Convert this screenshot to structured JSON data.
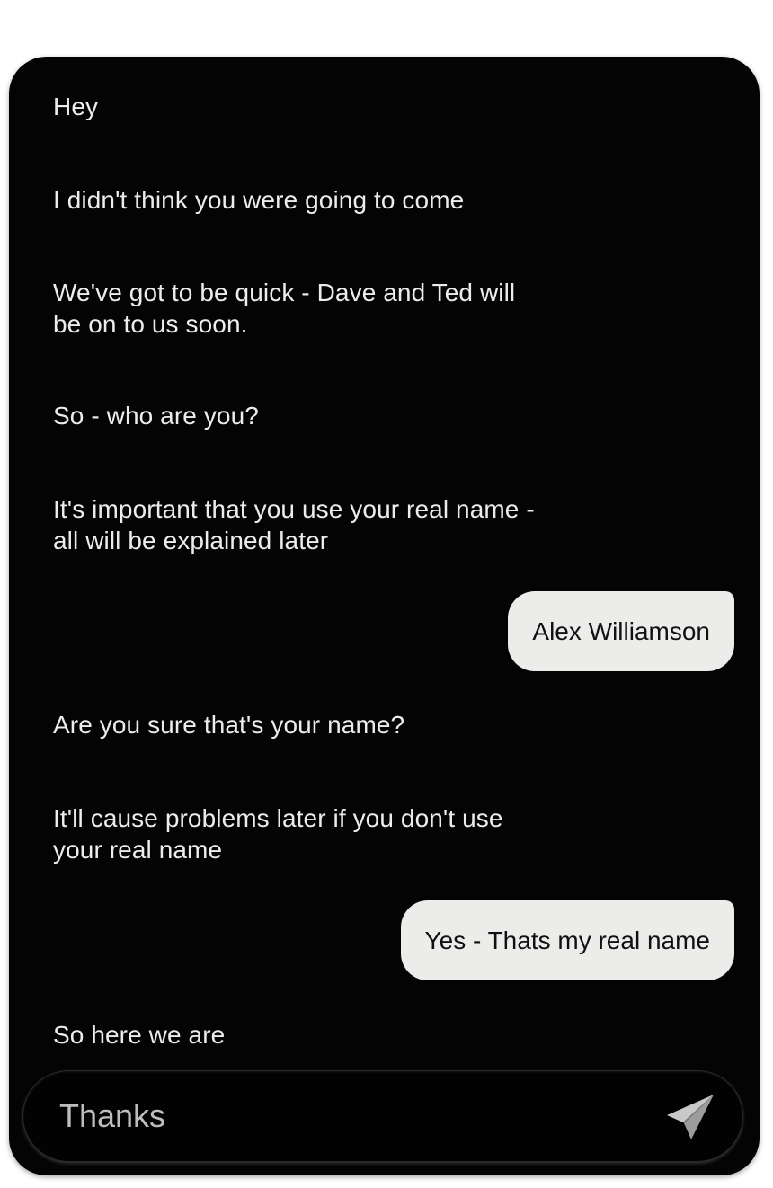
{
  "conversation": {
    "messages": [
      {
        "from": "them",
        "text": "Hey"
      },
      {
        "from": "them",
        "text": "I didn't think you were going to come"
      },
      {
        "from": "them",
        "text": "We've got to be quick - Dave and Ted will be on to us soon."
      },
      {
        "from": "them",
        "text": "So - who are you?"
      },
      {
        "from": "them",
        "text": "It's important that you use your real name - all will be explained later"
      },
      {
        "from": "me",
        "text": "Alex Williamson"
      },
      {
        "from": "them",
        "text": "Are you sure that's your name?"
      },
      {
        "from": "them",
        "text": "It'll cause problems later if you don't use your real name"
      },
      {
        "from": "me",
        "text": "Yes - Thats my real name"
      },
      {
        "from": "them",
        "text": "So here we are"
      }
    ]
  },
  "composer": {
    "value": "Thanks",
    "send_icon": "paper-plane-icon"
  },
  "colors": {
    "background": "#040404",
    "incoming_text": "#ececec",
    "outgoing_bubble": "#ececea",
    "outgoing_text": "#111111",
    "composer_text": "#bdbdbd",
    "send_icon": "#c9c9c9"
  }
}
